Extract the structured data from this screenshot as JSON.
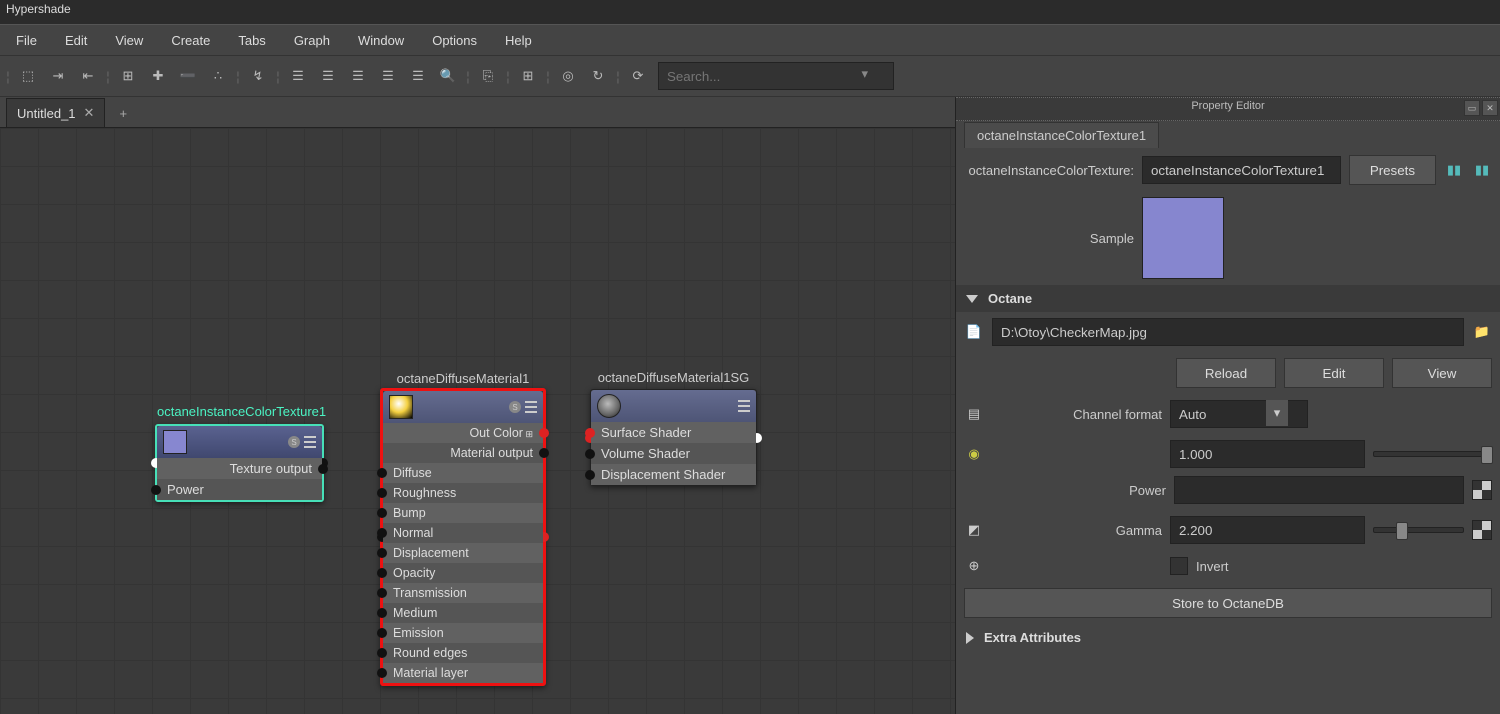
{
  "title": "Hypershade",
  "menu": [
    "File",
    "Edit",
    "View",
    "Create",
    "Tabs",
    "Graph",
    "Window",
    "Options",
    "Help"
  ],
  "search_placeholder": "Search...",
  "tabs": {
    "active": "Untitled_1"
  },
  "nodes": {
    "n1": {
      "title": "octaneInstanceColorTexture1",
      "rows": [
        "Texture output",
        "Power"
      ]
    },
    "n2": {
      "title": "octaneDiffuseMaterial1",
      "out": [
        "Out Color",
        "Material output"
      ],
      "in": [
        "Diffuse",
        "Roughness",
        "Bump",
        "Normal",
        "Displacement",
        "Opacity",
        "Transmission",
        "Medium",
        "Emission",
        "Round edges",
        "Material layer"
      ]
    },
    "n3": {
      "title": "octaneDiffuseMaterial1SG",
      "rows": [
        "Surface Shader",
        "Volume Shader",
        "Displacement Shader"
      ]
    }
  },
  "prop": {
    "panel_title": "Property Editor",
    "tab": "octaneInstanceColorTexture1",
    "type_label": "octaneInstanceColorTexture:",
    "name": "octaneInstanceColorTexture1",
    "presets": "Presets",
    "sample_label": "Sample",
    "section": "Octane",
    "filepath": "D:\\Otoy\\CheckerMap.jpg",
    "btn_reload": "Reload",
    "btn_edit": "Edit",
    "btn_view": "View",
    "channel_label": "Channel format",
    "channel_value": "Auto",
    "power_label": "Power",
    "power_value": "1.000",
    "gamma_label": "Gamma",
    "gamma_value": "2.200",
    "invert_label": "Invert",
    "store_btn": "Store to OctaneDB",
    "extra_section": "Extra Attributes"
  }
}
